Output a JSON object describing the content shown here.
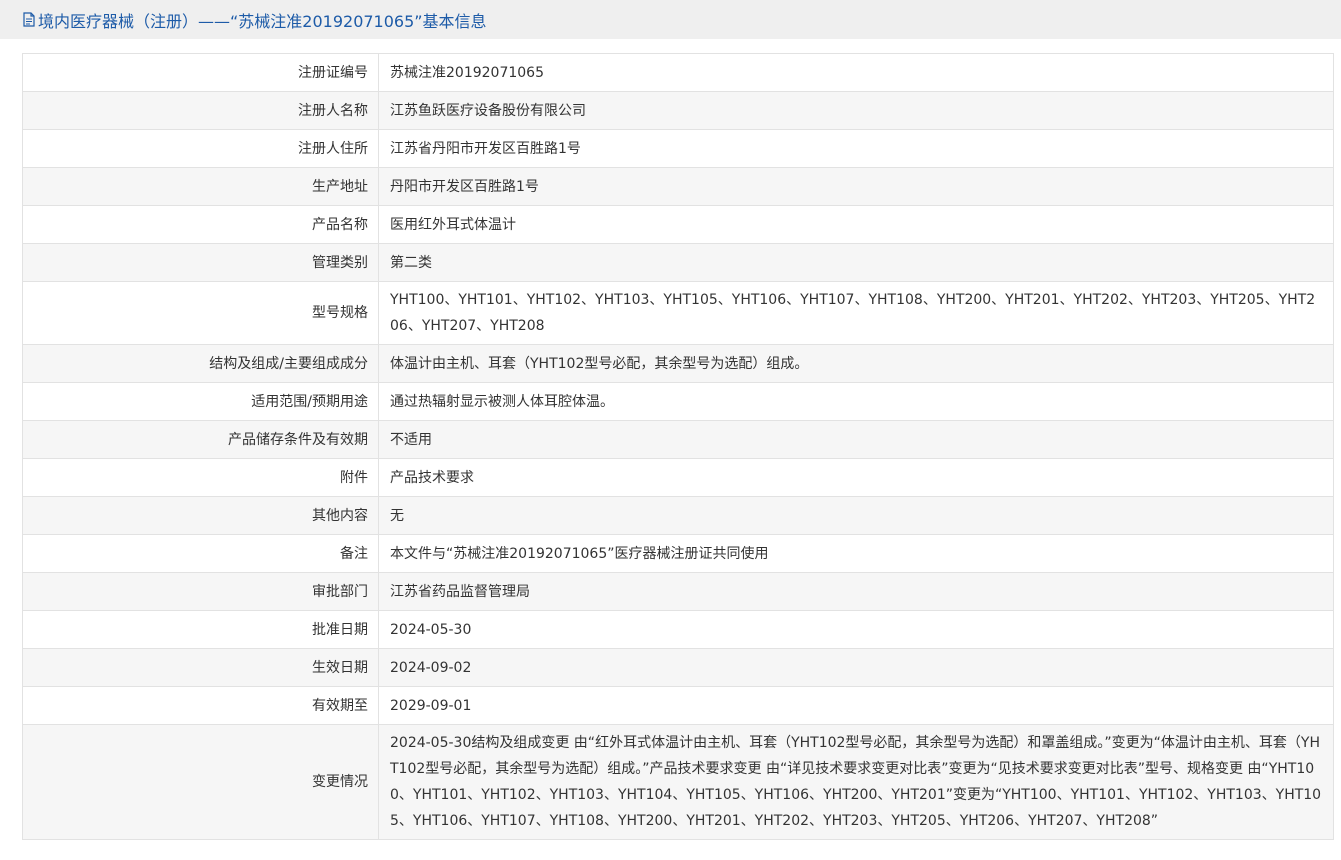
{
  "header": {
    "icon": "document-icon",
    "title": "境内医疗器械（注册）——“苏械注准20192071065”基本信息"
  },
  "rows": [
    {
      "label": "注册证编号",
      "value": "苏械注准20192071065"
    },
    {
      "label": "注册人名称",
      "value": "江苏鱼跃医疗设备股份有限公司"
    },
    {
      "label": "注册人住所",
      "value": "江苏省丹阳市开发区百胜路1号"
    },
    {
      "label": "生产地址",
      "value": "丹阳市开发区百胜路1号"
    },
    {
      "label": "产品名称",
      "value": "医用红外耳式体温计"
    },
    {
      "label": "管理类别",
      "value": "第二类"
    },
    {
      "label": "型号规格",
      "value": "YHT100、YHT101、YHT102、YHT103、YHT105、YHT106、YHT107、YHT108、YHT200、YHT201、YHT202、YHT203、YHT205、YHT206、YHT207、YHT208"
    },
    {
      "label": "结构及组成/主要组成成分",
      "value": "体温计由主机、耳套（YHT102型号必配，其余型号为选配）组成。"
    },
    {
      "label": "适用范围/预期用途",
      "value": "通过热辐射显示被测人体耳腔体温。"
    },
    {
      "label": "产品储存条件及有效期",
      "value": "不适用"
    },
    {
      "label": "附件",
      "value": "产品技术要求"
    },
    {
      "label": "其他内容",
      "value": "无"
    },
    {
      "label": "备注",
      "value": "本文件与“苏械注准20192071065”医疗器械注册证共同使用"
    },
    {
      "label": "审批部门",
      "value": "江苏省药品监督管理局"
    },
    {
      "label": "批准日期",
      "value": "2024-05-30"
    },
    {
      "label": "生效日期",
      "value": "2024-09-02"
    },
    {
      "label": "有效期至",
      "value": "2029-09-01"
    },
    {
      "label": "变更情况",
      "value": "2024-05-30结构及组成变更 由“红外耳式体温计由主机、耳套（YHT102型号必配，其余型号为选配）和罩盖组成。”变更为“体温计由主机、耳套（YHT102型号必配，其余型号为选配）组成。”产品技术要求变更 由“详见技术要求变更对比表”变更为“见技术要求变更对比表”型号、规格变更 由“YHT100、YHT101、YHT102、YHT103、YHT104、YHT105、YHT106、YHT200、YHT201”变更为“YHT100、YHT101、YHT102、YHT103、YHT105、YHT106、YHT107、YHT108、YHT200、YHT201、YHT202、YHT203、YHT205、YHT206、YHT207、YHT208”"
    }
  ]
}
